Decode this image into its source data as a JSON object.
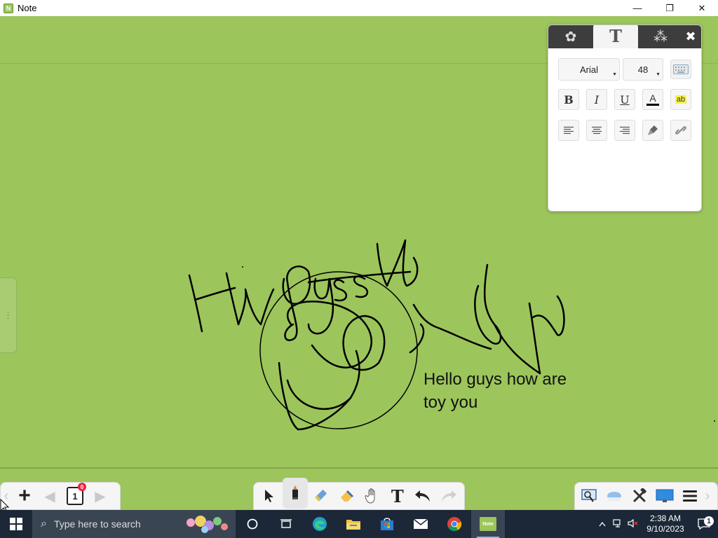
{
  "window": {
    "title": "Note",
    "app_icon_letter": "N",
    "minimize": "—",
    "maximize": "❐",
    "close": "✕"
  },
  "canvas": {
    "background": "#9cc55b",
    "side_tab_icon": "⋮",
    "note_text_line1": "Hello guys how are",
    "note_text_line2": "toy you"
  },
  "text_panel": {
    "tabs": [
      "objects-icon",
      "text-icon",
      "effects-icon"
    ],
    "active_tab_label": "T",
    "close_label": "✖",
    "font_family": "Arial",
    "font_size": "48",
    "bold_label": "B",
    "italic_label": "I",
    "underline_label": "U",
    "font_color_label": "A",
    "highlight_label": "ab"
  },
  "page_nav": {
    "add_label": "+",
    "prev_label": "◀",
    "next_label": "▶",
    "page_number": "1",
    "badge": "0"
  },
  "tools": [
    "select-icon",
    "pen-icon",
    "highlighter-icon",
    "eraser-icon",
    "hand-icon",
    "text-tool-icon",
    "undo-icon",
    "redo-icon"
  ],
  "tools_text_label": "T",
  "right_tools": [
    "screen-capture-icon",
    "cloud-icon",
    "tools-icon",
    "display-icon",
    "menu-icon"
  ],
  "taskbar": {
    "search_placeholder": "Type here to search",
    "apps": [
      "cortana-icon",
      "task-view-icon",
      "edge-icon",
      "file-explorer-icon",
      "store-icon",
      "mail-icon",
      "chrome-icon",
      "note-app-icon"
    ],
    "note_app_label": "Note",
    "time": "2:38 AM",
    "date": "9/10/2023",
    "notification_count": "1"
  }
}
